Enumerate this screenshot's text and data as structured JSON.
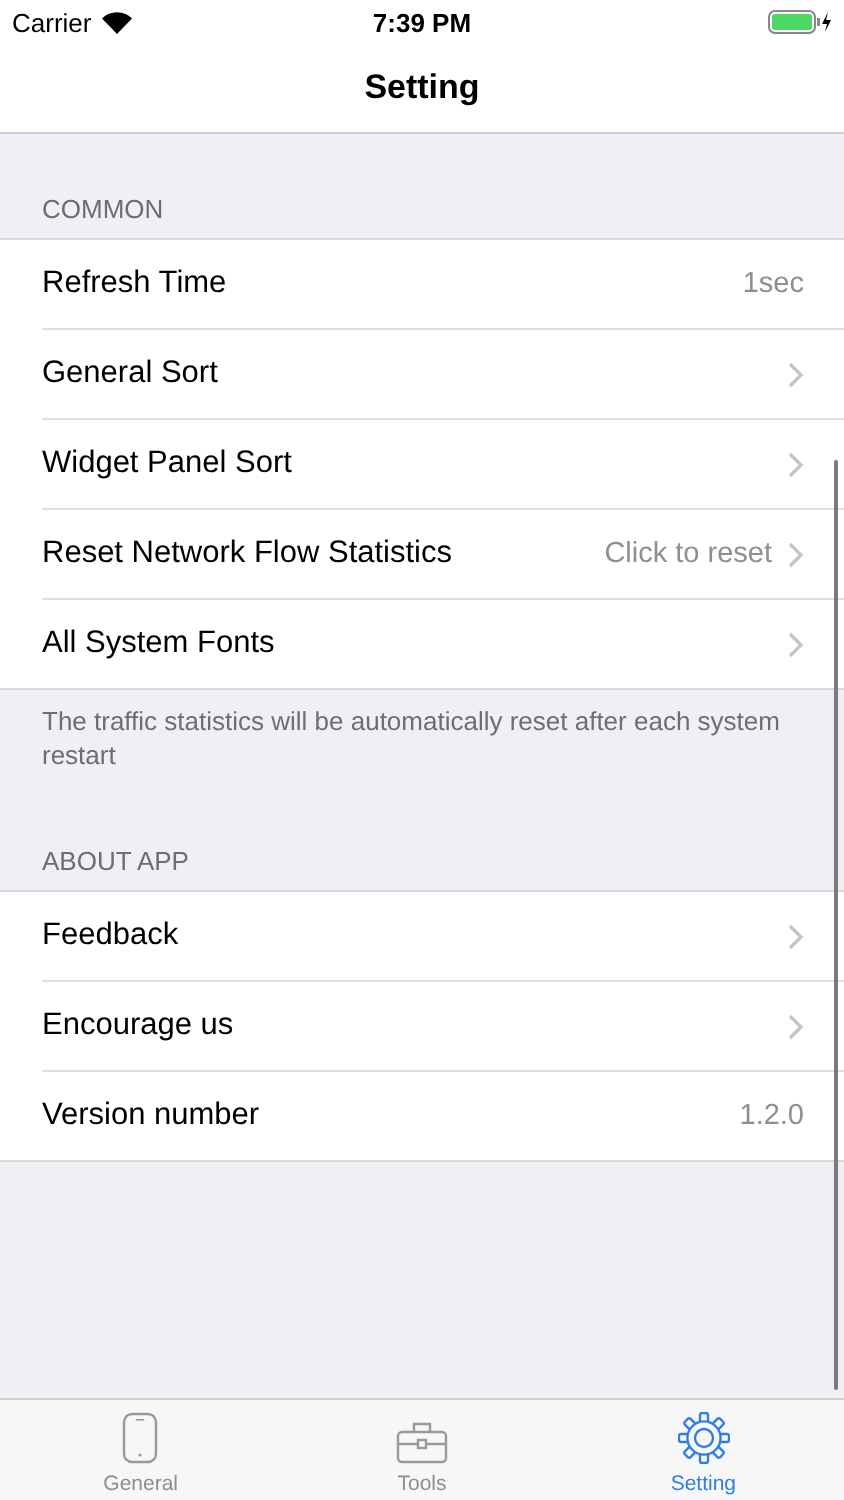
{
  "status_bar": {
    "carrier": "Carrier",
    "time": "7:39 PM"
  },
  "nav": {
    "title": "Setting"
  },
  "sections": [
    {
      "header": "COMMON",
      "footer": "The traffic statistics will be automatically reset after each system restart",
      "rows": [
        {
          "label": "Refresh Time",
          "value": "1sec",
          "chevron": false
        },
        {
          "label": "General Sort",
          "chevron": true
        },
        {
          "label": "Widget Panel Sort",
          "chevron": true
        },
        {
          "label": "Reset Network Flow Statistics",
          "value": "Click to reset",
          "chevron": true
        },
        {
          "label": "All System Fonts",
          "chevron": true
        }
      ]
    },
    {
      "header": "ABOUT APP",
      "rows": [
        {
          "label": "Feedback",
          "chevron": true
        },
        {
          "label": "Encourage us",
          "chevron": true
        },
        {
          "label": "Version number",
          "value": "1.2.0",
          "chevron": false
        }
      ]
    }
  ],
  "tabs": [
    {
      "kind": "phone",
      "label": "General",
      "selected": false
    },
    {
      "kind": "toolbox",
      "label": "Tools",
      "selected": false
    },
    {
      "kind": "gear",
      "label": "Setting",
      "selected": true
    }
  ]
}
